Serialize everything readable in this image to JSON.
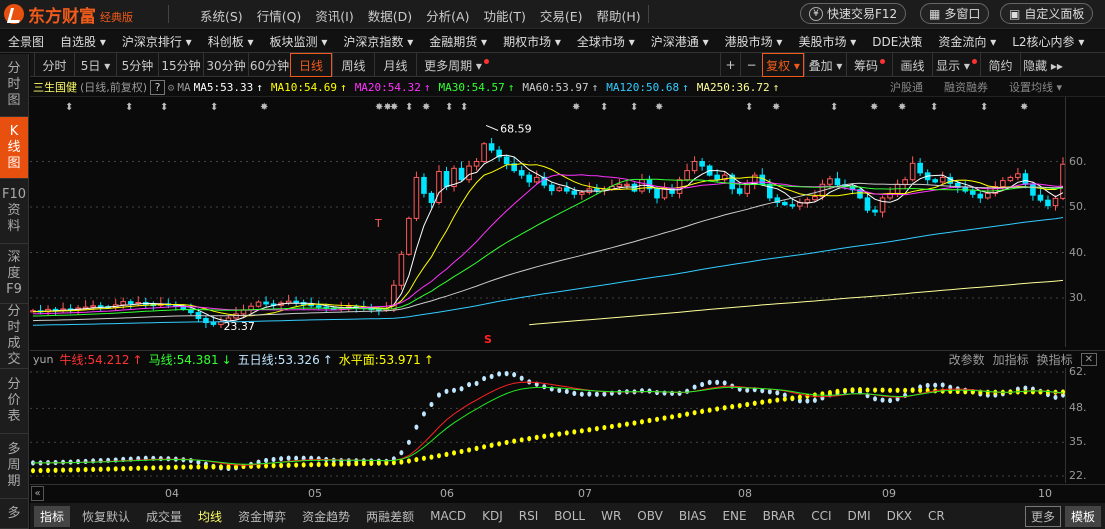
{
  "app": {
    "logo": "东方财富",
    "edition": "经典版"
  },
  "menu": [
    "系统(S)",
    "行情(Q)",
    "资讯(I)",
    "数据(D)",
    "分析(A)",
    "功能(T)",
    "交易(E)",
    "帮助(H)"
  ],
  "top_buttons": {
    "quick_trade": "快速交易F12",
    "multi_window": "多窗口",
    "custom_panel": "自定义面板"
  },
  "nav": [
    "全景图",
    "自选股 ▾",
    "沪深京排行 ▾",
    "科创板 ▾",
    "板块监测 ▾",
    "沪深京指数 ▾",
    "金融期货 ▾",
    "期权市场 ▾",
    "全球市场 ▾",
    "沪深港通 ▾",
    "港股市场 ▾",
    "美股市场 ▾",
    "DDE决策",
    "资金流向 ▾",
    "L2核心内参 ▾"
  ],
  "sidebar": [
    "分时图",
    "K线图",
    "F10资料",
    "深度F9",
    "分时成交",
    "分价表",
    "多周期",
    "多"
  ],
  "sidebar_active": 1,
  "periods": [
    "分时",
    "5日 ▾",
    "5分钟",
    "15分钟",
    "30分钟",
    "60分钟",
    "日线",
    "周线",
    "月线",
    "更多周期 ▾"
  ],
  "period_active": "日线",
  "tools": [
    "+",
    "−",
    "复权 ▾",
    "叠加 ▾",
    "筹码",
    "画线",
    "显示 ▾",
    "简约",
    "隐藏 ▸▸"
  ],
  "stock": {
    "name": "三生国健",
    "mode": "(日线,前复权)",
    "help": "?",
    "ma_label": "MA"
  },
  "ma": [
    {
      "label": "MA5:53.33",
      "arrow": "↑",
      "color": "#ffffff"
    },
    {
      "label": "MA10:54.69",
      "arrow": "↑",
      "color": "#ffff00"
    },
    {
      "label": "MA20:54.32",
      "arrow": "↑",
      "color": "#ff33ff"
    },
    {
      "label": "MA30:54.57",
      "arrow": "↑",
      "color": "#33ff33"
    },
    {
      "label": "MA60:53.97",
      "arrow": "↑",
      "color": "#cccccc"
    },
    {
      "label": "MA120:50.68",
      "arrow": "↑",
      "color": "#33ccff"
    },
    {
      "label": "MA250:36.72",
      "arrow": "↑",
      "color": "#ffff99"
    }
  ],
  "ma_links": [
    "沪股通",
    "融资融券",
    "设置均线 ▾"
  ],
  "price_axis": [
    "60.",
    "50.",
    "40.",
    "30."
  ],
  "annotations": {
    "high": "68.59",
    "low": "23.37",
    "t_mark": "T",
    "s_mark": "S"
  },
  "markers": [
    "⬍",
    "⬍",
    "⬍",
    "⬍",
    "✸",
    "✸✸",
    "✸",
    "⬍",
    "✸",
    "⬍",
    "⬍",
    "✸",
    "⬍",
    "⬍",
    "✸",
    "⬍",
    "✸",
    "⬍",
    "✸",
    "✸",
    "⬍",
    "⬍",
    "✸"
  ],
  "indicator": {
    "name": "yun",
    "items": [
      {
        "label": "牛线:54.212",
        "arrow": "↑",
        "color": "#ff3333"
      },
      {
        "label": "马线:54.381",
        "arrow": "↓",
        "color": "#33ff33"
      },
      {
        "label": "五日线:53.326",
        "arrow": "↑",
        "color": "#bfe6ff"
      },
      {
        "label": "水平面:53.971",
        "arrow": "↑",
        "color": "#ffff00"
      }
    ],
    "actions": [
      "改参数",
      "加指标",
      "换指标"
    ],
    "close": "✕",
    "axis": [
      "62.",
      "48.",
      "35.",
      "22."
    ]
  },
  "dates": [
    "04",
    "05",
    "06",
    "07",
    "08",
    "09",
    "10"
  ],
  "bottom_tabs": [
    "指标",
    "恢复默认",
    "成交量",
    "均线",
    "资金博弈",
    "资金趋势",
    "两融差额",
    "MACD",
    "KDJ",
    "RSI",
    "BOLL",
    "WR",
    "OBV",
    "BIAS",
    "ENE",
    "BRAR",
    "CCI",
    "DMI",
    "DKX",
    "CR",
    "更多",
    "模板"
  ],
  "colors": {
    "up": "#ff5a5a",
    "down": "#00e5ff",
    "accent": "#e8500f"
  },
  "chart_data": {
    "type": "candlestick",
    "closes": [
      27.2,
      27.0,
      27.5,
      27.3,
      27.6,
      27.4,
      27.8,
      28.0,
      28.3,
      28.1,
      27.9,
      28.5,
      29.2,
      28.8,
      29.0,
      28.6,
      28.4,
      28.7,
      28.5,
      28.2,
      27.5,
      26.8,
      25.5,
      24.6,
      24.2,
      24.8,
      25.6,
      26.5,
      27.4,
      28.2,
      29.1,
      28.7,
      28.4,
      28.9,
      29.3,
      29.0,
      28.6,
      28.3,
      28.0,
      27.8,
      27.6,
      27.9,
      28.1,
      28.0,
      27.7,
      27.5,
      27.3,
      27.6,
      32.8,
      39.6,
      47.5,
      56.5,
      53.0,
      51.0,
      57.8,
      54.5,
      58.5,
      56.0,
      59.0,
      60.0,
      63.9,
      62.5,
      61.0,
      59.5,
      58.0,
      57.0,
      55.5,
      56.5,
      54.8,
      53.6,
      54.2,
      53.5,
      52.8,
      53.2,
      54.0,
      53.7,
      53.9,
      54.5,
      55.0,
      55.0,
      53.5,
      56.0,
      54.0,
      52.0,
      54.0,
      53.0,
      56.0,
      58.0,
      60.0,
      59.0,
      57.0,
      56.0,
      57.0,
      54.0,
      53.0,
      55.0,
      57.0,
      55.0,
      52.0,
      51.0,
      50.5,
      50.2,
      51.0,
      51.6,
      52.3,
      55.0,
      56.2,
      54.9,
      54.5,
      53.8,
      52.0,
      49.3,
      48.9,
      52.0,
      53.0,
      55.0,
      56.0,
      59.6,
      57.5,
      56.0,
      55.5,
      56.5,
      55.2,
      54.3,
      53.5,
      52.8,
      52.0,
      53.0,
      54.5,
      55.8,
      56.5,
      57.3,
      55.0,
      52.6,
      51.5,
      50.3,
      51.9,
      59.4
    ],
    "high": 68.59,
    "low": 23.37,
    "ylim": [
      20,
      72
    ]
  }
}
